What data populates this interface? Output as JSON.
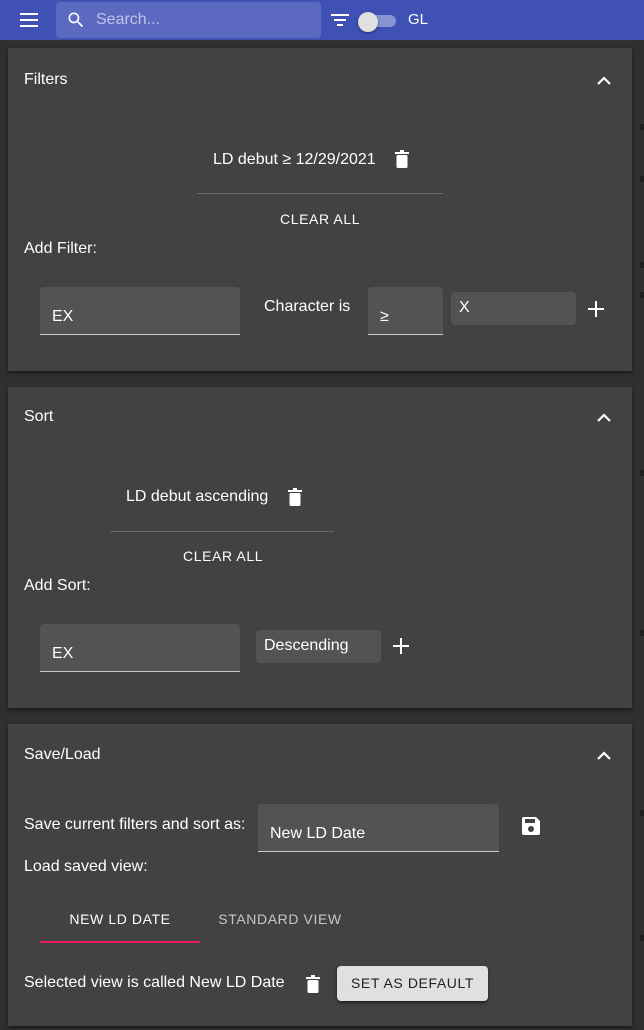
{
  "appbar": {
    "search_placeholder": "Search...",
    "toggle_label": "GL",
    "toggle_on": false,
    "color": "#3f51b5"
  },
  "filters": {
    "title": "Filters",
    "active": [
      {
        "label": "LD debut ≥ 12/29/2021"
      }
    ],
    "clear_all": "CLEAR ALL",
    "add_label": "Add Filter:",
    "field_value": "EX",
    "condition_text": "Character is",
    "operator_value": "≥",
    "value_input": "X"
  },
  "sort": {
    "title": "Sort",
    "active": [
      {
        "label": "LD debut ascending"
      }
    ],
    "clear_all": "CLEAR ALL",
    "add_label": "Add Sort:",
    "field_value": "EX",
    "direction_value": "Descending"
  },
  "saveload": {
    "title": "Save/Load",
    "save_label": "Save current filters and sort as:",
    "save_name_value": "New LD Date",
    "load_label": "Load saved view:",
    "tabs": [
      {
        "label": "NEW LD DATE",
        "selected": true
      },
      {
        "label": "STANDARD VIEW",
        "selected": false
      }
    ],
    "selected_text": "Selected view is called New LD Date",
    "default_button": "SET AS DEFAULT"
  },
  "icons": [
    "menu-icon",
    "search-icon",
    "filter-list-icon",
    "chevron-up-icon",
    "trash-icon",
    "plus-icon",
    "save-icon"
  ],
  "colors": {
    "accent": "#e91e63",
    "panel": "#424242",
    "background": "#303030"
  }
}
